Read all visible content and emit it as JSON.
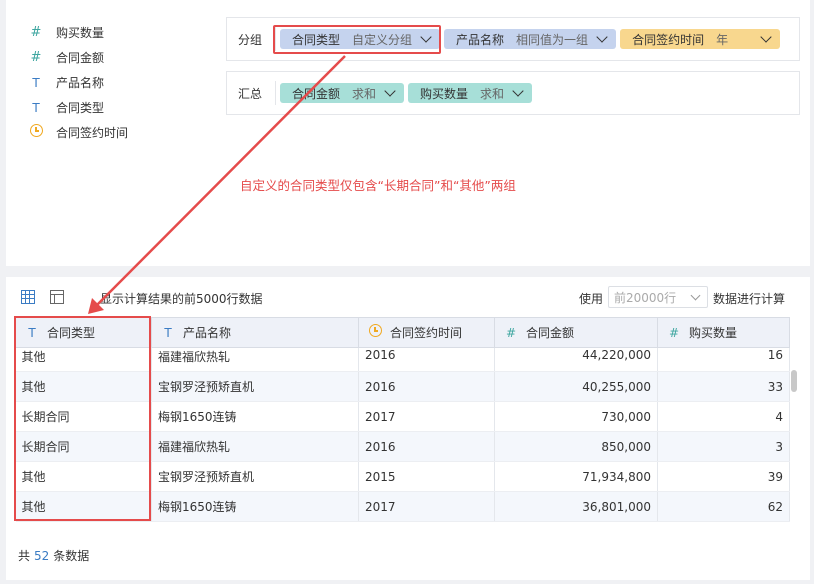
{
  "fields": [
    {
      "icon": "#",
      "type": "num",
      "name": "购买数量"
    },
    {
      "icon": "#",
      "type": "num",
      "name": "合同金额"
    },
    {
      "icon": "T",
      "type": "txt",
      "name": "产品名称"
    },
    {
      "icon": "T",
      "type": "txt",
      "name": "合同类型"
    },
    {
      "icon": "clock",
      "type": "date",
      "name": "合同签约时间"
    }
  ],
  "group": {
    "label": "分组",
    "pills": [
      {
        "name": "合同类型",
        "option": "自定义分组",
        "color": "#c5d3ee"
      },
      {
        "name": "产品名称",
        "option": "相同值为一组",
        "color": "#c5d3ee"
      },
      {
        "name": "合同签约时间",
        "option": "年",
        "color": "#f8d78e"
      }
    ]
  },
  "summary": {
    "label": "汇总",
    "pills": [
      {
        "name": "合同金额",
        "option": "求和",
        "color": "#a7dfd8"
      },
      {
        "name": "购买数量",
        "option": "求和",
        "color": "#a7dfd8"
      }
    ]
  },
  "annotation": "自定义的合同类型仅包含“长期合同”和“其他”两组",
  "toolbar": {
    "limit_text": "显示计算结果的前5000行数据",
    "use_label": "使用",
    "select_placeholder": "前20000行",
    "calc_text": "数据进行计算"
  },
  "table": {
    "headers": [
      {
        "icon": "T",
        "type": "txt",
        "label": "合同类型"
      },
      {
        "icon": "T",
        "type": "txt",
        "label": "产品名称"
      },
      {
        "icon": "clock",
        "type": "date",
        "label": "合同签约时间"
      },
      {
        "icon": "#",
        "type": "num",
        "label": "合同金额"
      },
      {
        "icon": "#",
        "type": "num",
        "label": "购买数量"
      }
    ],
    "rows": [
      [
        "其他",
        "福建福欣热轧",
        "2016",
        "44,220,000",
        "16"
      ],
      [
        "其他",
        "宝钢罗泾预矫直机",
        "2016",
        "40,255,000",
        "33"
      ],
      [
        "长期合同",
        "梅钢1650连铸",
        "2017",
        "730,000",
        "4"
      ],
      [
        "长期合同",
        "福建福欣热轧",
        "2016",
        "850,000",
        "3"
      ],
      [
        "其他",
        "宝钢罗泾预矫直机",
        "2015",
        "71,934,800",
        "39"
      ],
      [
        "其他",
        "梅钢1650连铸",
        "2017",
        "36,801,000",
        "62"
      ]
    ]
  },
  "footer": {
    "prefix": "共",
    "count": "52",
    "suffix": "条数据"
  },
  "colors": {
    "accent": "#3b7cc4",
    "highlight": "#e54b4b"
  }
}
